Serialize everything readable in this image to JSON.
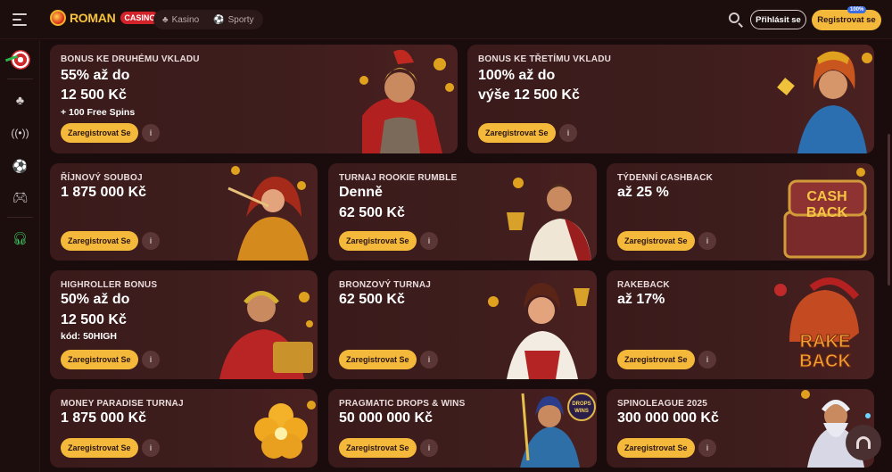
{
  "header": {
    "logo_main": "ROMAN",
    "logo_badge": "CASINO",
    "tabs": [
      {
        "label": "Kasino",
        "icon": "cherries-icon"
      },
      {
        "label": "Sporty",
        "icon": "soccer-ball-icon"
      }
    ],
    "login_label": "Přihlásit se",
    "register_label": "Registrovat se",
    "register_badge": "100%"
  },
  "sidebar": {
    "items": [
      "dart-icon",
      "cherries-icon",
      "live-icon",
      "soccer-ball-icon",
      "gamepad-icon",
      "headset-icon"
    ]
  },
  "cards": [
    {
      "label": "BONUS KE DRUHÉMU VKLADU",
      "lines": [
        "55% až do",
        "12 500 Kč"
      ],
      "sub": "+ 100 Free Spins",
      "cta": "Zaregistrovat Se",
      "info": "i"
    },
    {
      "label": "BONUS KE TŘETÍMU VKLADU",
      "lines": [
        "100% až do",
        "výše 12 500 Kč"
      ],
      "cta": "Zaregistrovat Se",
      "info": "i"
    },
    {
      "label": "ŘÍJNOVÝ SOUBOJ",
      "lines": [
        "1 875 000 Kč"
      ],
      "cta": "Zaregistrovat Se",
      "info": "i"
    },
    {
      "label": "TURNAJ ROOKIE RUMBLE",
      "lines": [
        "Denně",
        "62 500 Kč"
      ],
      "cta": "Zaregistrovat Se",
      "info": "i"
    },
    {
      "label": "TÝDENNÍ CASHBACK",
      "lines": [
        "až 25 %"
      ],
      "cta": "Zaregistrovat Se",
      "info": "i"
    },
    {
      "label": "HIGHROLLER BONUS",
      "lines": [
        "50% až do",
        "12 500 Kč"
      ],
      "sub": "kód: 50HIGH",
      "cta": "Zaregistrovat Se",
      "info": "i"
    },
    {
      "label": "BRONZOVÝ TURNAJ",
      "lines": [
        "62 500 Kč"
      ],
      "cta": "Zaregistrovat Se",
      "info": "i"
    },
    {
      "label": "RAKEBACK",
      "lines": [
        "až 17%"
      ],
      "cta": "Zaregistrovat Se",
      "info": "i"
    },
    {
      "label": "MONEY PARADISE TURNAJ",
      "lines": [
        "1 875 000 Kč"
      ],
      "cta": "Zaregistrovat Se",
      "info": "i"
    },
    {
      "label": "PRAGMATIC DROPS & WINS",
      "lines": [
        "50 000 000 Kč"
      ],
      "cta": "Zaregistrovat Se",
      "info": "i"
    },
    {
      "label": "SPINOLEAGUE 2025",
      "lines": [
        "300 000 000 Kč"
      ],
      "cta": "Zaregistrovat Se",
      "info": "i"
    }
  ],
  "art_text": {
    "cashback": [
      "CASH",
      "BACK"
    ],
    "rakeback": [
      "RAKE",
      "BACK"
    ],
    "drops": [
      "DROPS",
      "WINS"
    ]
  },
  "colors": {
    "accent": "#f4b93b",
    "background": "#1a0c0c",
    "card": "#3a1a1a"
  }
}
